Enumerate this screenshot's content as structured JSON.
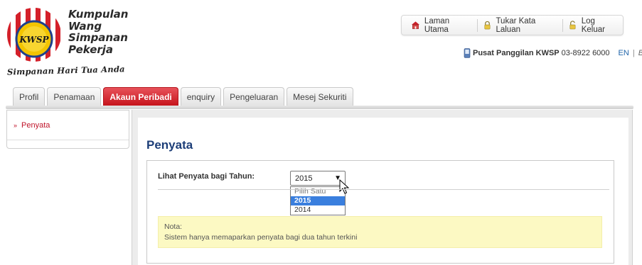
{
  "header": {
    "brand_lines": [
      "Kumpulan",
      "Wang",
      "Simpanan",
      "Pekerja"
    ],
    "emblem_text": "KWSP",
    "tagline": "Simpanan Hari Tua Anda"
  },
  "top_nav": {
    "items": [
      {
        "label": "Laman Utama",
        "icon": "home-icon"
      },
      {
        "label": "Tukar Kata Laluan",
        "icon": "lock-icon"
      },
      {
        "label": "Log Keluar",
        "icon": "unlock-icon"
      }
    ]
  },
  "contact": {
    "label": "Pusat Panggilan KWSP",
    "phone": "03-8922 6000",
    "lang_en": "EN",
    "lang_sep": "|",
    "lang_bm": "BM"
  },
  "tabs": [
    {
      "label": "Profil",
      "active": false
    },
    {
      "label": "Penamaan",
      "active": false
    },
    {
      "label": "Akaun Peribadi",
      "active": true
    },
    {
      "label": "enquiry",
      "active": false
    },
    {
      "label": "Pengeluaran",
      "active": false
    },
    {
      "label": "Mesej Sekuriti",
      "active": false
    }
  ],
  "sidebar": {
    "items": [
      {
        "label": "Penyata"
      }
    ]
  },
  "main": {
    "title": "Penyata",
    "form_label": "Lihat Penyata bagi Tahun:",
    "select": {
      "value": "2015",
      "options": [
        "Pilih Satu",
        "2015",
        "2014"
      ],
      "highlighted": "2015"
    },
    "note_title": "Nota:",
    "note_text": "Sistem hanya memaparkan penyata bagi dua tahun terkini"
  },
  "colors": {
    "accent_red": "#c6141c",
    "title_blue": "#1d3e78",
    "note_bg": "#fcf9c3",
    "selected_option": "#3a7fde"
  }
}
